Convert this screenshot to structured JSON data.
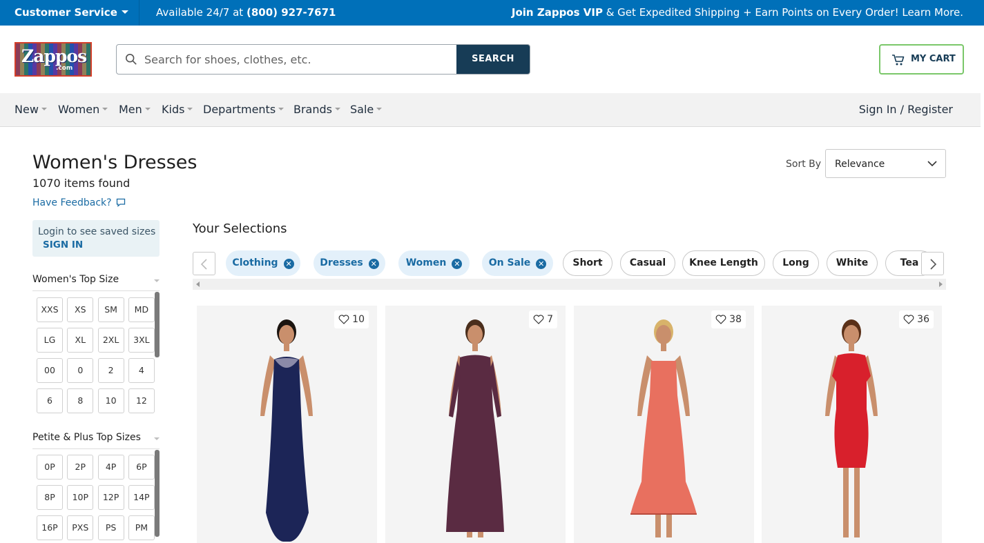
{
  "topbar": {
    "customer_service": "Customer Service",
    "available_prefix": "Available 24/7 at ",
    "phone": "(800) 927-7671",
    "vip_bold": "Join Zappos VIP",
    "vip_rest": " & Get Expedited Shipping + Earn Points on Every Order! Learn More."
  },
  "header": {
    "logo_text": "Zappos",
    "logo_com": ".com",
    "search_placeholder": "Search for shoes, clothes, etc.",
    "search_button": "SEARCH",
    "cart_label": "MY CART"
  },
  "nav": {
    "items": [
      "New",
      "Women",
      "Men",
      "Kids",
      "Departments",
      "Brands",
      "Sale"
    ],
    "signin": "Sign In / Register"
  },
  "page": {
    "title": "Women's Dresses",
    "count": "1070 items found",
    "feedback": "Have Feedback?",
    "sort_label": "Sort By",
    "sort_value": "Relevance"
  },
  "sidebar": {
    "login_text": "Login to see saved sizes",
    "signin": "SIGN IN",
    "top_size_title": "Women's Top Size",
    "top_sizes": [
      "XXS",
      "XS",
      "SM",
      "MD",
      "LG",
      "XL",
      "2XL",
      "3XL",
      "00",
      "0",
      "2",
      "4",
      "6",
      "8",
      "10",
      "12"
    ],
    "petite_title": "Petite & Plus Top Sizes",
    "petite_sizes": [
      "0P",
      "2P",
      "4P",
      "6P",
      "8P",
      "10P",
      "12P",
      "14P",
      "16P",
      "PXS",
      "PS",
      "PM"
    ]
  },
  "selections": {
    "title": "Your Selections",
    "active": [
      "Clothing",
      "Dresses",
      "Women",
      "On Sale"
    ],
    "suggested": [
      "Short",
      "Casual",
      "Knee Length",
      "Long",
      "White",
      "Tea"
    ]
  },
  "products": [
    {
      "favorites": "10",
      "dress_color": "#1c2557",
      "icon": "navy-gown"
    },
    {
      "favorites": "7",
      "dress_color": "#5a2b42",
      "icon": "plum-maxi-dress"
    },
    {
      "favorites": "38",
      "dress_color": "#e8705f",
      "icon": "coral-floral-dress"
    },
    {
      "favorites": "36",
      "dress_color": "#d8202c",
      "icon": "red-sheath-dress"
    }
  ],
  "colors": {
    "brand_blue": "#0070b9",
    "navy": "#173c56",
    "cart_green": "#7ac769",
    "link_blue": "#1a6ba3"
  }
}
